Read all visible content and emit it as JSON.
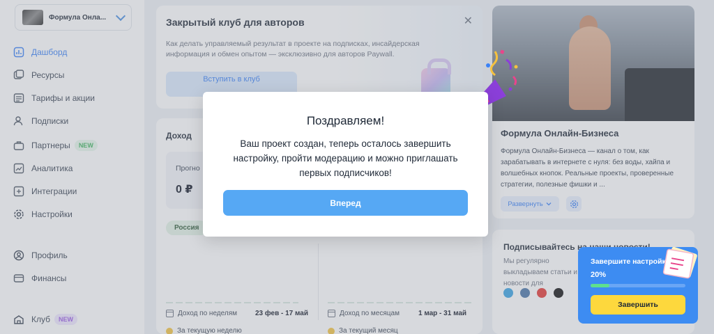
{
  "sidebar": {
    "project_name": "Формула Онла...",
    "items": [
      {
        "label": "Дашборд",
        "icon": "dashboard-icon",
        "active": true
      },
      {
        "label": "Ресурсы",
        "icon": "resources-icon"
      },
      {
        "label": "Тарифы и акции",
        "icon": "tariffs-icon"
      },
      {
        "label": "Подписки",
        "icon": "subscriptions-icon"
      },
      {
        "label": "Партнеры",
        "icon": "partners-icon",
        "badge": "NEW"
      },
      {
        "label": "Аналитика",
        "icon": "analytics-icon"
      },
      {
        "label": "Интеграции",
        "icon": "integrations-icon"
      },
      {
        "label": "Настройки",
        "icon": "settings-icon"
      },
      {
        "label": "Профиль",
        "icon": "profile-icon"
      },
      {
        "label": "Финансы",
        "icon": "finance-icon"
      },
      {
        "label": "Клуб",
        "icon": "club-icon",
        "badge": "NEW"
      }
    ]
  },
  "club_card": {
    "title": "Закрытый клуб для авторов",
    "description": "Как делать управляемый результат в проекте на подписках, инсайдерская информация и обмен опытом — эксклюзивно для авторов Paywall.",
    "button": "Вступить в клуб",
    "close": "✕"
  },
  "income": {
    "title": "Доход",
    "forecast_label": "Прогно",
    "forecast_value": "0 ₽",
    "country": "Россия",
    "weekly_label": "Доход по неделям",
    "weekly_range": "23 фев - 17 май",
    "monthly_label": "Доход по месяцам",
    "monthly_range": "1 мар - 31 май",
    "current_week": "За текущую неделю",
    "current_month": "За текущий месяц"
  },
  "channel": {
    "title": "Формула Онлайн-Бизнеса",
    "description": "Формула Онлайн-Бизнеса — канал о том, как зарабатывать в интернете с нуля: без воды, хайпа и волшебных кнопок. Реальные проекты, проверенные стратегии, полезные фишки и ...",
    "expand": "Развернуть"
  },
  "news": {
    "title": "Подписывайтесь на наши новости!",
    "description": "Мы регулярно выкладываем статьи и новости для"
  },
  "modal": {
    "title": "Поздравляем!",
    "text": "Ваш проект создан, теперь осталось завершить настройку, пройти модерацию и можно приглашать первых подписчиков!",
    "button": "Вперед"
  },
  "setup": {
    "title": "Завершите настройку",
    "percent": "20%",
    "progress": 0.2,
    "button": "Завершить"
  },
  "colors": {
    "accent": "#3b82f6",
    "modal_button": "#56a8f4",
    "setup_bg": "#3d8cf2",
    "setup_button": "#fdd83d",
    "progress_fill": "#5ee08e"
  }
}
